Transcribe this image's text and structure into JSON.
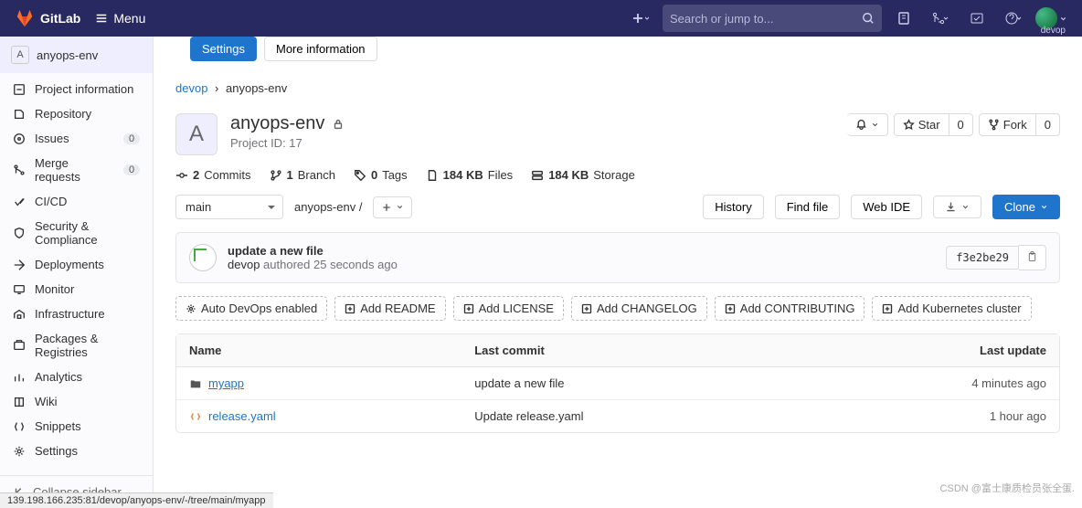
{
  "nav": {
    "brand": "GitLab",
    "menu": "Menu",
    "search_placeholder": "Search or jump to...",
    "user": "devop"
  },
  "sidebar": {
    "project_letter": "A",
    "project_name": "anyops-env",
    "items": [
      {
        "label": "Project information",
        "badge": null
      },
      {
        "label": "Repository",
        "badge": null
      },
      {
        "label": "Issues",
        "badge": "0"
      },
      {
        "label": "Merge requests",
        "badge": "0"
      },
      {
        "label": "CI/CD",
        "badge": null
      },
      {
        "label": "Security & Compliance",
        "badge": null
      },
      {
        "label": "Deployments",
        "badge": null
      },
      {
        "label": "Monitor",
        "badge": null
      },
      {
        "label": "Infrastructure",
        "badge": null
      },
      {
        "label": "Packages & Registries",
        "badge": null
      },
      {
        "label": "Analytics",
        "badge": null
      },
      {
        "label": "Wiki",
        "badge": null
      },
      {
        "label": "Snippets",
        "badge": null
      },
      {
        "label": "Settings",
        "badge": null
      }
    ],
    "collapse": "Collapse sidebar"
  },
  "tabs": {
    "settings": "Settings",
    "more_info": "More information"
  },
  "breadcrumb": {
    "group": "devop",
    "project": "anyops-env"
  },
  "project": {
    "avatar": "A",
    "name": "anyops-env",
    "id_label": "Project ID: 17",
    "star": "Star",
    "star_count": "0",
    "fork": "Fork",
    "fork_count": "0"
  },
  "stats": {
    "commits_n": "2",
    "commits_l": "Commits",
    "branches_n": "1",
    "branches_l": "Branch",
    "tags_n": "0",
    "tags_l": "Tags",
    "files_size": "184 KB",
    "files_l": "Files",
    "storage_size": "184 KB",
    "storage_l": "Storage"
  },
  "ref": {
    "branch": "main",
    "path": "anyops-env",
    "history": "History",
    "find_file": "Find file",
    "web_ide": "Web IDE",
    "clone": "Clone"
  },
  "commit": {
    "message": "update a new file",
    "author": "devop",
    "authored": "authored",
    "time": "25 seconds ago",
    "sha": "f3e2be29"
  },
  "chips": {
    "auto_devops": "Auto DevOps enabled",
    "readme": "Add README",
    "license": "Add LICENSE",
    "changelog": "Add CHANGELOG",
    "contributing": "Add CONTRIBUTING",
    "k8s": "Add Kubernetes cluster"
  },
  "files": {
    "h_name": "Name",
    "h_commit": "Last commit",
    "h_update": "Last update",
    "rows": [
      {
        "type": "dir",
        "name": "myapp",
        "commit": "update a new file",
        "update": "4 minutes ago"
      },
      {
        "type": "yaml",
        "name": "release.yaml",
        "commit": "Update release.yaml",
        "update": "1 hour ago"
      }
    ]
  },
  "status_bar": "139.198.166.235:81/devop/anyops-env/-/tree/main/myapp",
  "watermark": "CSDN @富士康质检员张全蛋."
}
